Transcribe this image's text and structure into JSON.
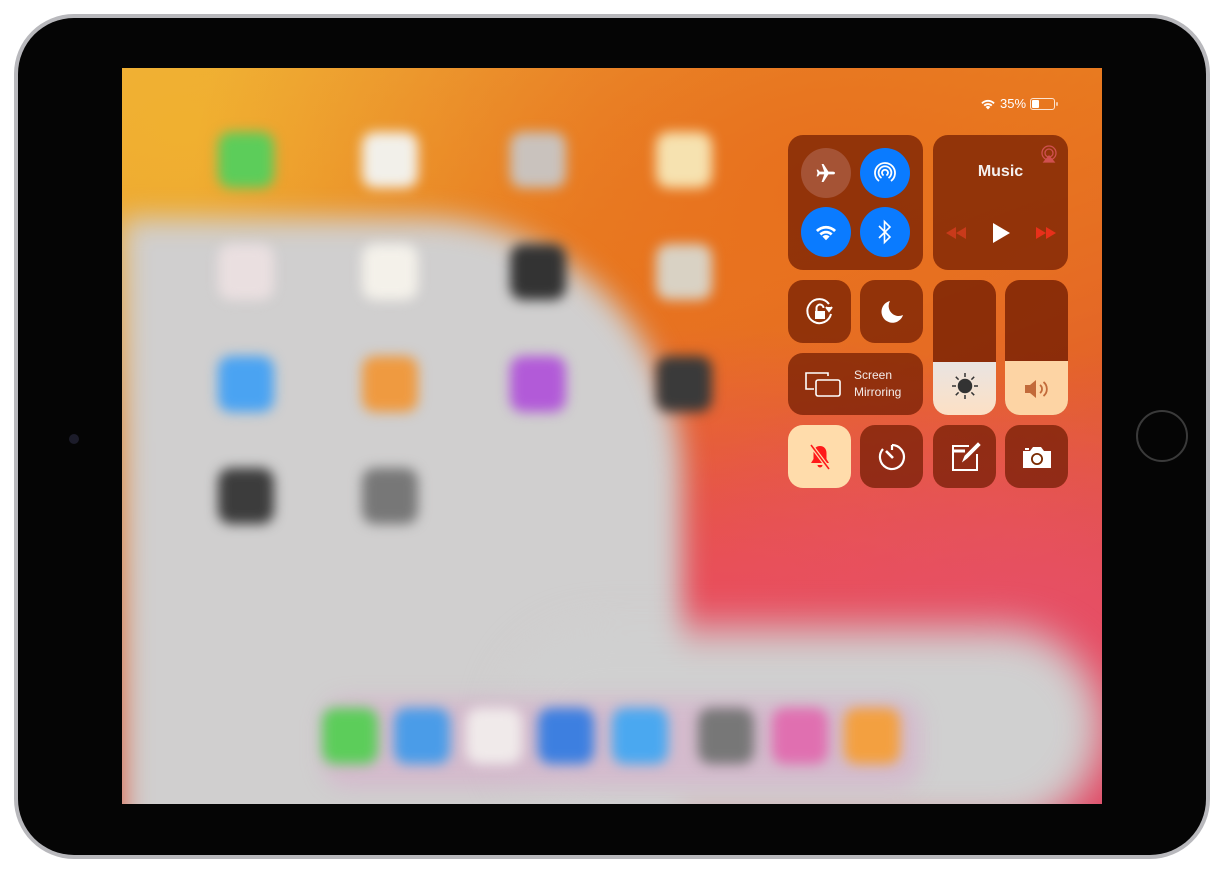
{
  "status_bar": {
    "battery_text": "35%",
    "battery_level": 0.35,
    "wifi_icon": "wifi-icon"
  },
  "connectivity": {
    "airplane_mode": false,
    "airdrop": true,
    "wifi": true,
    "bluetooth": true
  },
  "music": {
    "title": "Music"
  },
  "screen_mirroring": {
    "line1": "Screen",
    "line2": "Mirroring"
  },
  "brightness": {
    "level_percent": 39
  },
  "volume": {
    "level_percent": 40
  },
  "silent_mode": true,
  "colors": {
    "accent_blue": "#0a7bff",
    "tile_bg": "#6e1900",
    "active_tile": "#ffd9a8",
    "mute_red": "#ff1a1a"
  }
}
